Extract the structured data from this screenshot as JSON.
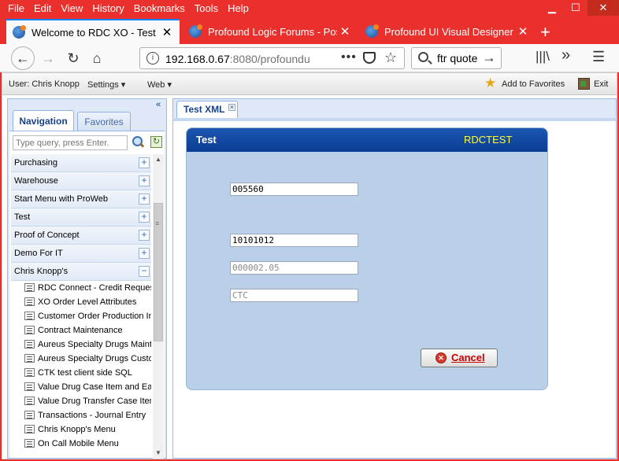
{
  "menu": [
    "File",
    "Edit",
    "View",
    "History",
    "Bookmarks",
    "Tools",
    "Help"
  ],
  "tabs": [
    {
      "title": "Welcome to RDC XO - Test",
      "active": true
    },
    {
      "title": "Profound Logic Forums - Post a",
      "active": false
    },
    {
      "title": "Profound UI Visual Designer",
      "active": false
    }
  ],
  "newtab": "+",
  "address": {
    "host": "192.168.0.67",
    "rest": ":8080/profoundu",
    "dots": "•••"
  },
  "search": {
    "value": "ftr quote",
    "go": "→"
  },
  "appbar": {
    "user": "User: Chris Knopp",
    "settings": "Settings ▾",
    "web": "Web ▾",
    "favorites": "Add to Favorites",
    "exit": "Exit"
  },
  "nav": {
    "tab_navigation": "Navigation",
    "tab_favorites": "Favorites",
    "query_placeholder": "Type query, press Enter.",
    "categories": [
      "Purchasing",
      "Warehouse",
      "Start Menu with ProWeb",
      "Test",
      "Proof of Concept",
      "Demo For IT"
    ],
    "expanded": {
      "label": "Chris Knopp's",
      "toggle": "−"
    },
    "plus": "+",
    "items": [
      "RDC Connect - Credit Requests",
      "XO Order Level Attributes",
      "Customer Order Production Inquiry",
      "Contract Maintenance",
      "Aureus Specialty Drugs Maintenance",
      "Aureus Specialty Drugs Customers",
      "CTK test client side SQL",
      "Value Drug Case Item and Each",
      "Value Drug Transfer Case Item",
      "Transactions - Journal Entry",
      "Chris Knopp's Menu",
      "On Call Mobile Menu"
    ]
  },
  "content_tab": "Test XML",
  "form": {
    "title": "Test",
    "program": "RDCTEST",
    "field1": "005560",
    "field2": "10101012",
    "field3": "000002.05",
    "field4": "CTC",
    "cancel": "Cancel"
  }
}
